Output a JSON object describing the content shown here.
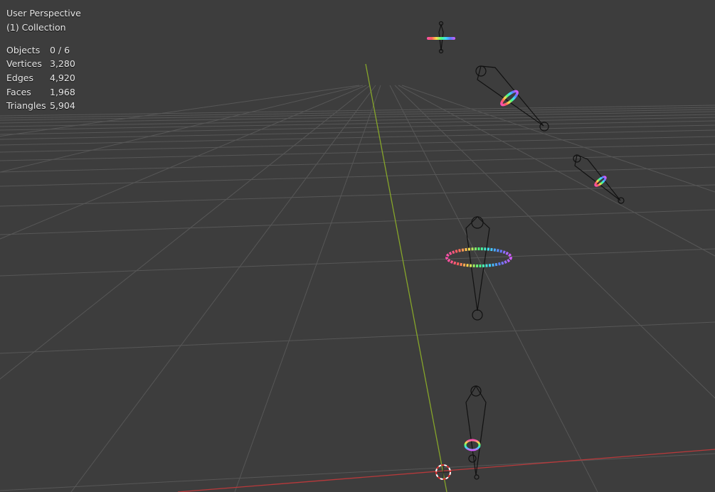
{
  "viewport": {
    "mode": "User Perspective",
    "collection": "(1) Collection",
    "background_color": "#3d3d3d",
    "grid_color": "#555555",
    "x_axis_color": "#c0393b",
    "y_axis_color": "#7c9a28"
  },
  "stats": {
    "rows": [
      {
        "label": "Objects",
        "value": "0 / 6"
      },
      {
        "label": "Vertices",
        "value": "3,280"
      },
      {
        "label": "Edges",
        "value": "4,920"
      },
      {
        "label": "Faces",
        "value": "1,968"
      },
      {
        "label": "Triangles",
        "value": "5,904"
      }
    ]
  },
  "scene_objects": [
    {
      "name": "armature-bone",
      "count": 5
    },
    {
      "name": "rainbow-ring",
      "count": 5
    },
    {
      "name": "3d-cursor",
      "count": 1
    }
  ]
}
